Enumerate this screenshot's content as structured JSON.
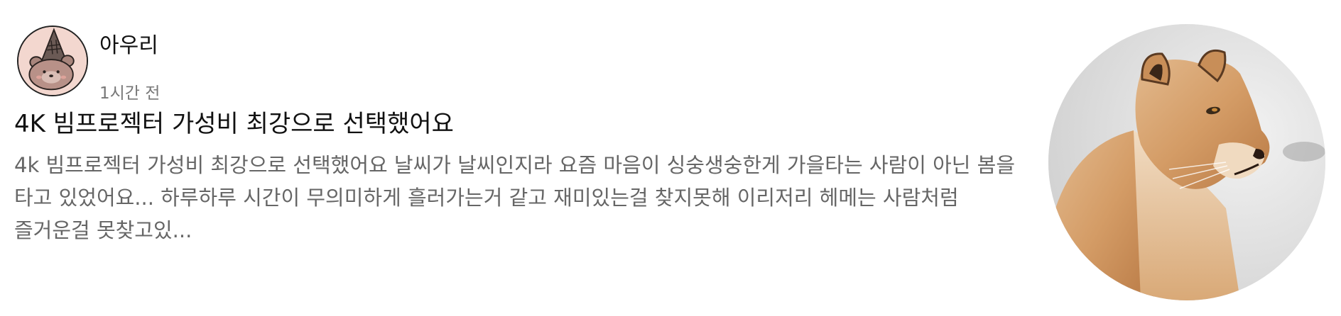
{
  "post": {
    "author": {
      "name": "아우리",
      "timestamp": "1시간 전",
      "avatar_icon": "bear-with-party-hat-icon"
    },
    "title": "4K 빔프로젝터 가성비 최강으로 선택했어요",
    "excerpt": "4k 빔프로젝터 가성비 최강으로 선택했어요 날씨가 날씨인지라 요즘 마음이 싱숭생숭한게 가을타는 사람이 아닌 봄을 타고 있었어요... 하루하루 시간이 무의미하게 흘러가는거 같고 재미있는걸 찾지못해 이리저리 헤메는 사람처럼 즐거운걸 못찾고있...",
    "thumbnail": {
      "subject": "lioness"
    }
  },
  "colors": {
    "title": "#111111",
    "excerpt": "#666666",
    "timestamp": "#777777",
    "avatar_bg": "#f3d7cf"
  }
}
